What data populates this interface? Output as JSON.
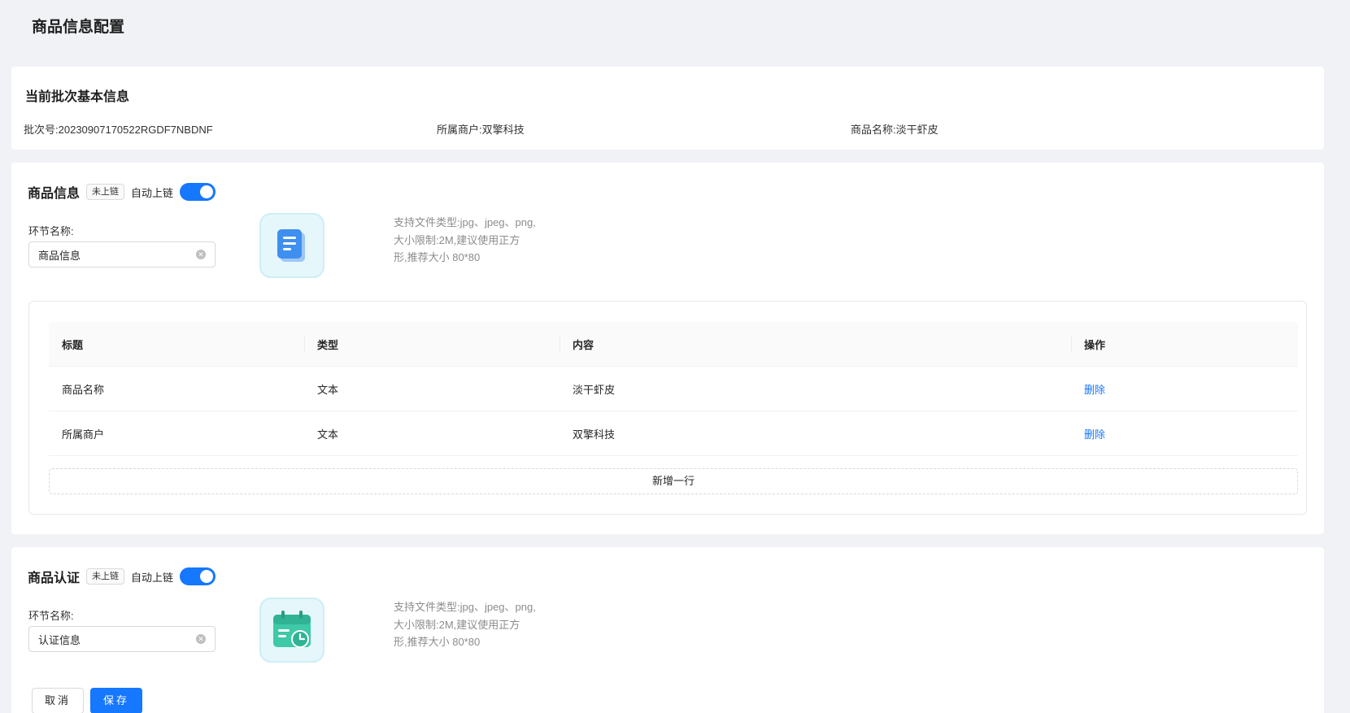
{
  "page": {
    "title": "商品信息配置"
  },
  "basic": {
    "title": "当前批次基本信息",
    "batch_label": "批次号:",
    "batch_value": "20230907170522RGDF7NBDNF",
    "merchant_label": "所属商户:",
    "merchant_value": "双擎科技",
    "product_label": "商品名称:",
    "product_value": "淡干虾皮"
  },
  "section1": {
    "title": "商品信息",
    "tag": "未上链",
    "auto_label": "自动上链",
    "auto_on": true,
    "field_label": "环节名称:",
    "field_value": "商品信息",
    "upload_icon": "document-icon",
    "hint": [
      "支持文件类型:jpg、jpeg、png,",
      "大小限制:2M,建议使用正方",
      "形,推荐大小 80*80"
    ],
    "table": {
      "headers": [
        "标题",
        "类型",
        "内容",
        "操作"
      ],
      "rows": [
        {
          "title": "商品名称",
          "type": "文本",
          "content": "淡干虾皮",
          "action": "删除"
        },
        {
          "title": "所属商户",
          "type": "文本",
          "content": "双擎科技",
          "action": "删除"
        }
      ],
      "add_row": "新增一行"
    }
  },
  "section2": {
    "title": "商品认证",
    "tag": "未上链",
    "auto_label": "自动上链",
    "auto_on": true,
    "field_label": "环节名称:",
    "field_value": "认证信息",
    "upload_icon": "calendar-clock-icon",
    "hint": [
      "支持文件类型:jpg、jpeg、png,",
      "大小限制:2M,建议使用正方",
      "形,推荐大小 80*80"
    ]
  },
  "footer": {
    "cancel": "取消",
    "save": "保存"
  },
  "colors": {
    "primary": "#1677ff",
    "background": "#f0f2f5"
  }
}
